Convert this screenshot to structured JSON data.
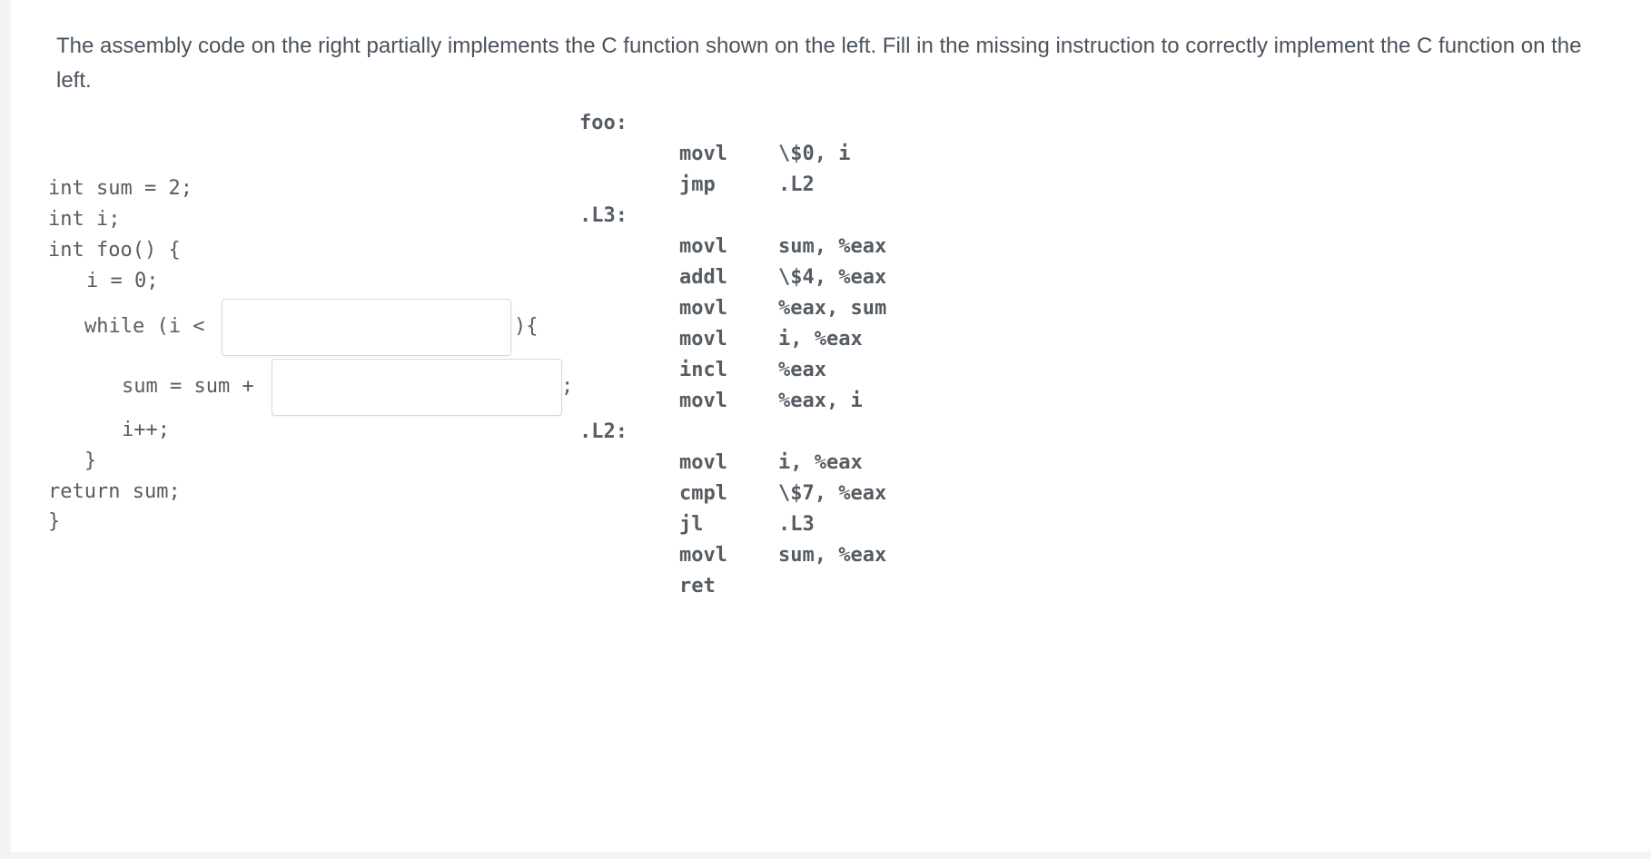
{
  "prompt": "The assembly code on the right partially implements the C function shown on the left. Fill in the missing instruction to correctly implement the C function on the left.",
  "c_code": {
    "line1": "int sum = 2;",
    "line2": "int i;",
    "line3": "int foo() {",
    "line4": "i = 0;",
    "while_prefix": "while (i <",
    "while_suffix": "){",
    "sum_prefix": "sum = sum +",
    "sum_suffix": ";",
    "incr": "i++;",
    "close_loop": "}",
    "ret": "return sum;",
    "close_fn": "}"
  },
  "blanks": {
    "loop_bound_value": "",
    "sum_addend_value": ""
  },
  "assembly": {
    "labels": {
      "foo": "foo:",
      "l3": ".L3:",
      "l2": ".L2:"
    },
    "instructions": [
      {
        "op": "movl",
        "args": "\\$0, i"
      },
      {
        "op": "jmp",
        "args": ".L2"
      },
      {
        "op": "movl",
        "args": "sum, %eax"
      },
      {
        "op": "addl",
        "args": "\\$4, %eax"
      },
      {
        "op": "movl",
        "args": "%eax, sum"
      },
      {
        "op": "movl",
        "args": "i, %eax"
      },
      {
        "op": "incl",
        "args": "%eax"
      },
      {
        "op": "movl",
        "args": "%eax, i"
      },
      {
        "op": "movl",
        "args": "i, %eax"
      },
      {
        "op": "cmpl",
        "args": "\\$7, %eax"
      },
      {
        "op": "jl",
        "args": ".L3"
      },
      {
        "op": "movl",
        "args": "sum, %eax"
      },
      {
        "op": "ret",
        "args": ""
      }
    ]
  }
}
